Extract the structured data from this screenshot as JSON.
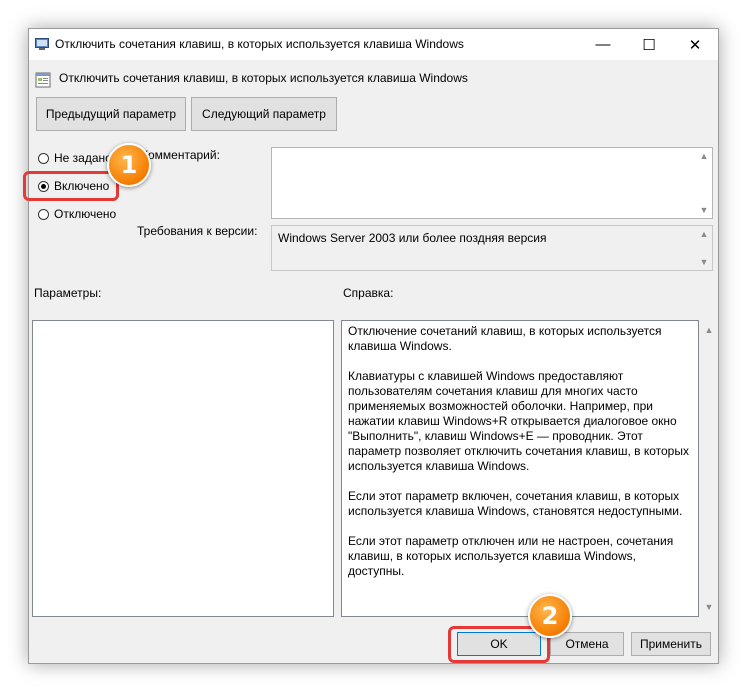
{
  "window": {
    "title": "Отключить сочетания клавиш, в которых используется клавиша Windows",
    "controls": {
      "minimize": "—",
      "maximize": "☐",
      "close": "✕"
    }
  },
  "header": {
    "title": "Отключить сочетания клавиш, в которых используется клавиша Windows"
  },
  "nav": {
    "prev_label": "Предыдущий параметр",
    "next_label": "Следующий параметр"
  },
  "state": {
    "options": [
      {
        "label": "Не задано",
        "checked": false
      },
      {
        "label": "Включено",
        "checked": true
      },
      {
        "label": "Отключено",
        "checked": false
      }
    ]
  },
  "comment": {
    "label": "Комментарий:",
    "value": ""
  },
  "supported": {
    "label": "Требования к версии:",
    "value": "Windows Server 2003 или более поздняя версия"
  },
  "params": {
    "label": "Параметры:"
  },
  "help": {
    "label": "Справка:",
    "paragraphs": [
      "Отключение сочетаний клавиш, в которых используется клавиша Windows.",
      "Клавиатуры с клавишей Windows предоставляют пользователям сочетания клавиш для многих часто применяемых возможностей оболочки. Например, при нажатии клавиш Windows+R открывается диалоговое окно \"Выполнить\", клавиш Windows+E — проводник. Этот параметр позволяет отключить сочетания клавиш, в которых используется клавиша Windows.",
      "Если этот параметр включен, сочетания клавиш, в которых используется клавиша Windows, становятся недоступными.",
      "Если этот параметр отключен или не настроен, сочетания клавиш, в которых используется клавиша Windows, доступны."
    ]
  },
  "buttons": {
    "ok": "OK",
    "cancel": "Отмена",
    "apply": "Применить"
  },
  "annotations": {
    "badge1": "1",
    "badge2": "2",
    "color": "#e53935",
    "badge_color": "#f57c00"
  }
}
